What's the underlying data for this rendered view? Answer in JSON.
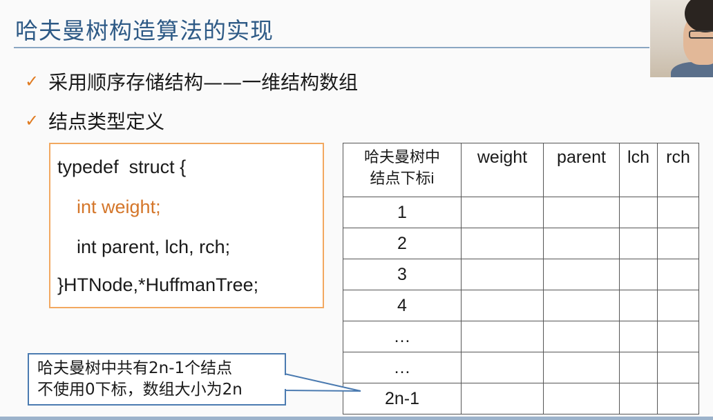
{
  "title": "哈夫曼树构造算法的实现",
  "bullets": [
    "采用顺序存储结构——一维结构数组",
    "结点类型定义"
  ],
  "code": {
    "line1": "typedef  struct {",
    "line2": "int weight;",
    "line3": "int parent, lch, rch;",
    "line4": "}HTNode,*HuffmanTree;"
  },
  "table": {
    "header_index_line1": "哈夫曼树中",
    "header_index_line2": "结点下标i",
    "headers": [
      "weight",
      "parent",
      "lch",
      "rch"
    ],
    "rows": [
      "1",
      "2",
      "3",
      "4",
      "…",
      "…",
      "2n-1"
    ]
  },
  "callout": {
    "line1": "哈夫曼树中共有2n-1个结点",
    "line2": "不使用0下标，数组大小为2n"
  },
  "colors": {
    "title": "#2e5a86",
    "check": "#e07a1f",
    "code_highlight": "#d4762a",
    "code_border": "#f2a860",
    "callout_border": "#4a7ab0"
  },
  "icons": {
    "bullet": "checkmark-icon"
  }
}
